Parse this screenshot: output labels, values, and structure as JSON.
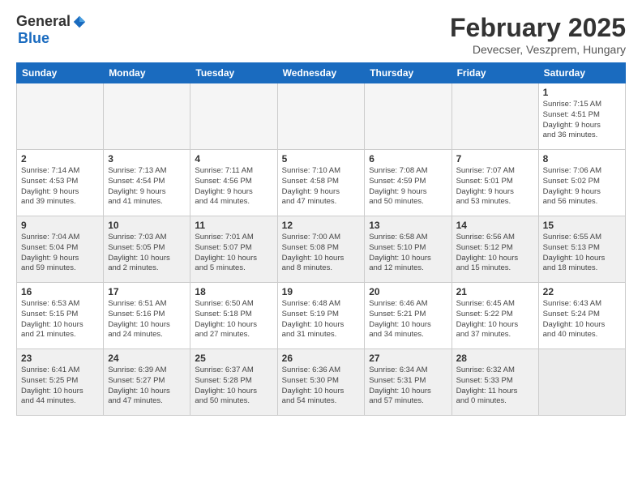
{
  "logo": {
    "general": "General",
    "blue": "Blue"
  },
  "title": "February 2025",
  "subtitle": "Devecser, Veszprem, Hungary",
  "columns": [
    "Sunday",
    "Monday",
    "Tuesday",
    "Wednesday",
    "Thursday",
    "Friday",
    "Saturday"
  ],
  "weeks": [
    {
      "shade": false,
      "days": [
        {
          "num": "",
          "detail": ""
        },
        {
          "num": "",
          "detail": ""
        },
        {
          "num": "",
          "detail": ""
        },
        {
          "num": "",
          "detail": ""
        },
        {
          "num": "",
          "detail": ""
        },
        {
          "num": "",
          "detail": ""
        },
        {
          "num": "1",
          "detail": "Sunrise: 7:15 AM\nSunset: 4:51 PM\nDaylight: 9 hours\nand 36 minutes."
        }
      ]
    },
    {
      "shade": false,
      "days": [
        {
          "num": "2",
          "detail": "Sunrise: 7:14 AM\nSunset: 4:53 PM\nDaylight: 9 hours\nand 39 minutes."
        },
        {
          "num": "3",
          "detail": "Sunrise: 7:13 AM\nSunset: 4:54 PM\nDaylight: 9 hours\nand 41 minutes."
        },
        {
          "num": "4",
          "detail": "Sunrise: 7:11 AM\nSunset: 4:56 PM\nDaylight: 9 hours\nand 44 minutes."
        },
        {
          "num": "5",
          "detail": "Sunrise: 7:10 AM\nSunset: 4:58 PM\nDaylight: 9 hours\nand 47 minutes."
        },
        {
          "num": "6",
          "detail": "Sunrise: 7:08 AM\nSunset: 4:59 PM\nDaylight: 9 hours\nand 50 minutes."
        },
        {
          "num": "7",
          "detail": "Sunrise: 7:07 AM\nSunset: 5:01 PM\nDaylight: 9 hours\nand 53 minutes."
        },
        {
          "num": "8",
          "detail": "Sunrise: 7:06 AM\nSunset: 5:02 PM\nDaylight: 9 hours\nand 56 minutes."
        }
      ]
    },
    {
      "shade": true,
      "days": [
        {
          "num": "9",
          "detail": "Sunrise: 7:04 AM\nSunset: 5:04 PM\nDaylight: 9 hours\nand 59 minutes."
        },
        {
          "num": "10",
          "detail": "Sunrise: 7:03 AM\nSunset: 5:05 PM\nDaylight: 10 hours\nand 2 minutes."
        },
        {
          "num": "11",
          "detail": "Sunrise: 7:01 AM\nSunset: 5:07 PM\nDaylight: 10 hours\nand 5 minutes."
        },
        {
          "num": "12",
          "detail": "Sunrise: 7:00 AM\nSunset: 5:08 PM\nDaylight: 10 hours\nand 8 minutes."
        },
        {
          "num": "13",
          "detail": "Sunrise: 6:58 AM\nSunset: 5:10 PM\nDaylight: 10 hours\nand 12 minutes."
        },
        {
          "num": "14",
          "detail": "Sunrise: 6:56 AM\nSunset: 5:12 PM\nDaylight: 10 hours\nand 15 minutes."
        },
        {
          "num": "15",
          "detail": "Sunrise: 6:55 AM\nSunset: 5:13 PM\nDaylight: 10 hours\nand 18 minutes."
        }
      ]
    },
    {
      "shade": false,
      "days": [
        {
          "num": "16",
          "detail": "Sunrise: 6:53 AM\nSunset: 5:15 PM\nDaylight: 10 hours\nand 21 minutes."
        },
        {
          "num": "17",
          "detail": "Sunrise: 6:51 AM\nSunset: 5:16 PM\nDaylight: 10 hours\nand 24 minutes."
        },
        {
          "num": "18",
          "detail": "Sunrise: 6:50 AM\nSunset: 5:18 PM\nDaylight: 10 hours\nand 27 minutes."
        },
        {
          "num": "19",
          "detail": "Sunrise: 6:48 AM\nSunset: 5:19 PM\nDaylight: 10 hours\nand 31 minutes."
        },
        {
          "num": "20",
          "detail": "Sunrise: 6:46 AM\nSunset: 5:21 PM\nDaylight: 10 hours\nand 34 minutes."
        },
        {
          "num": "21",
          "detail": "Sunrise: 6:45 AM\nSunset: 5:22 PM\nDaylight: 10 hours\nand 37 minutes."
        },
        {
          "num": "22",
          "detail": "Sunrise: 6:43 AM\nSunset: 5:24 PM\nDaylight: 10 hours\nand 40 minutes."
        }
      ]
    },
    {
      "shade": true,
      "days": [
        {
          "num": "23",
          "detail": "Sunrise: 6:41 AM\nSunset: 5:25 PM\nDaylight: 10 hours\nand 44 minutes."
        },
        {
          "num": "24",
          "detail": "Sunrise: 6:39 AM\nSunset: 5:27 PM\nDaylight: 10 hours\nand 47 minutes."
        },
        {
          "num": "25",
          "detail": "Sunrise: 6:37 AM\nSunset: 5:28 PM\nDaylight: 10 hours\nand 50 minutes."
        },
        {
          "num": "26",
          "detail": "Sunrise: 6:36 AM\nSunset: 5:30 PM\nDaylight: 10 hours\nand 54 minutes."
        },
        {
          "num": "27",
          "detail": "Sunrise: 6:34 AM\nSunset: 5:31 PM\nDaylight: 10 hours\nand 57 minutes."
        },
        {
          "num": "28",
          "detail": "Sunrise: 6:32 AM\nSunset: 5:33 PM\nDaylight: 11 hours\nand 0 minutes."
        },
        {
          "num": "",
          "detail": ""
        }
      ]
    }
  ]
}
